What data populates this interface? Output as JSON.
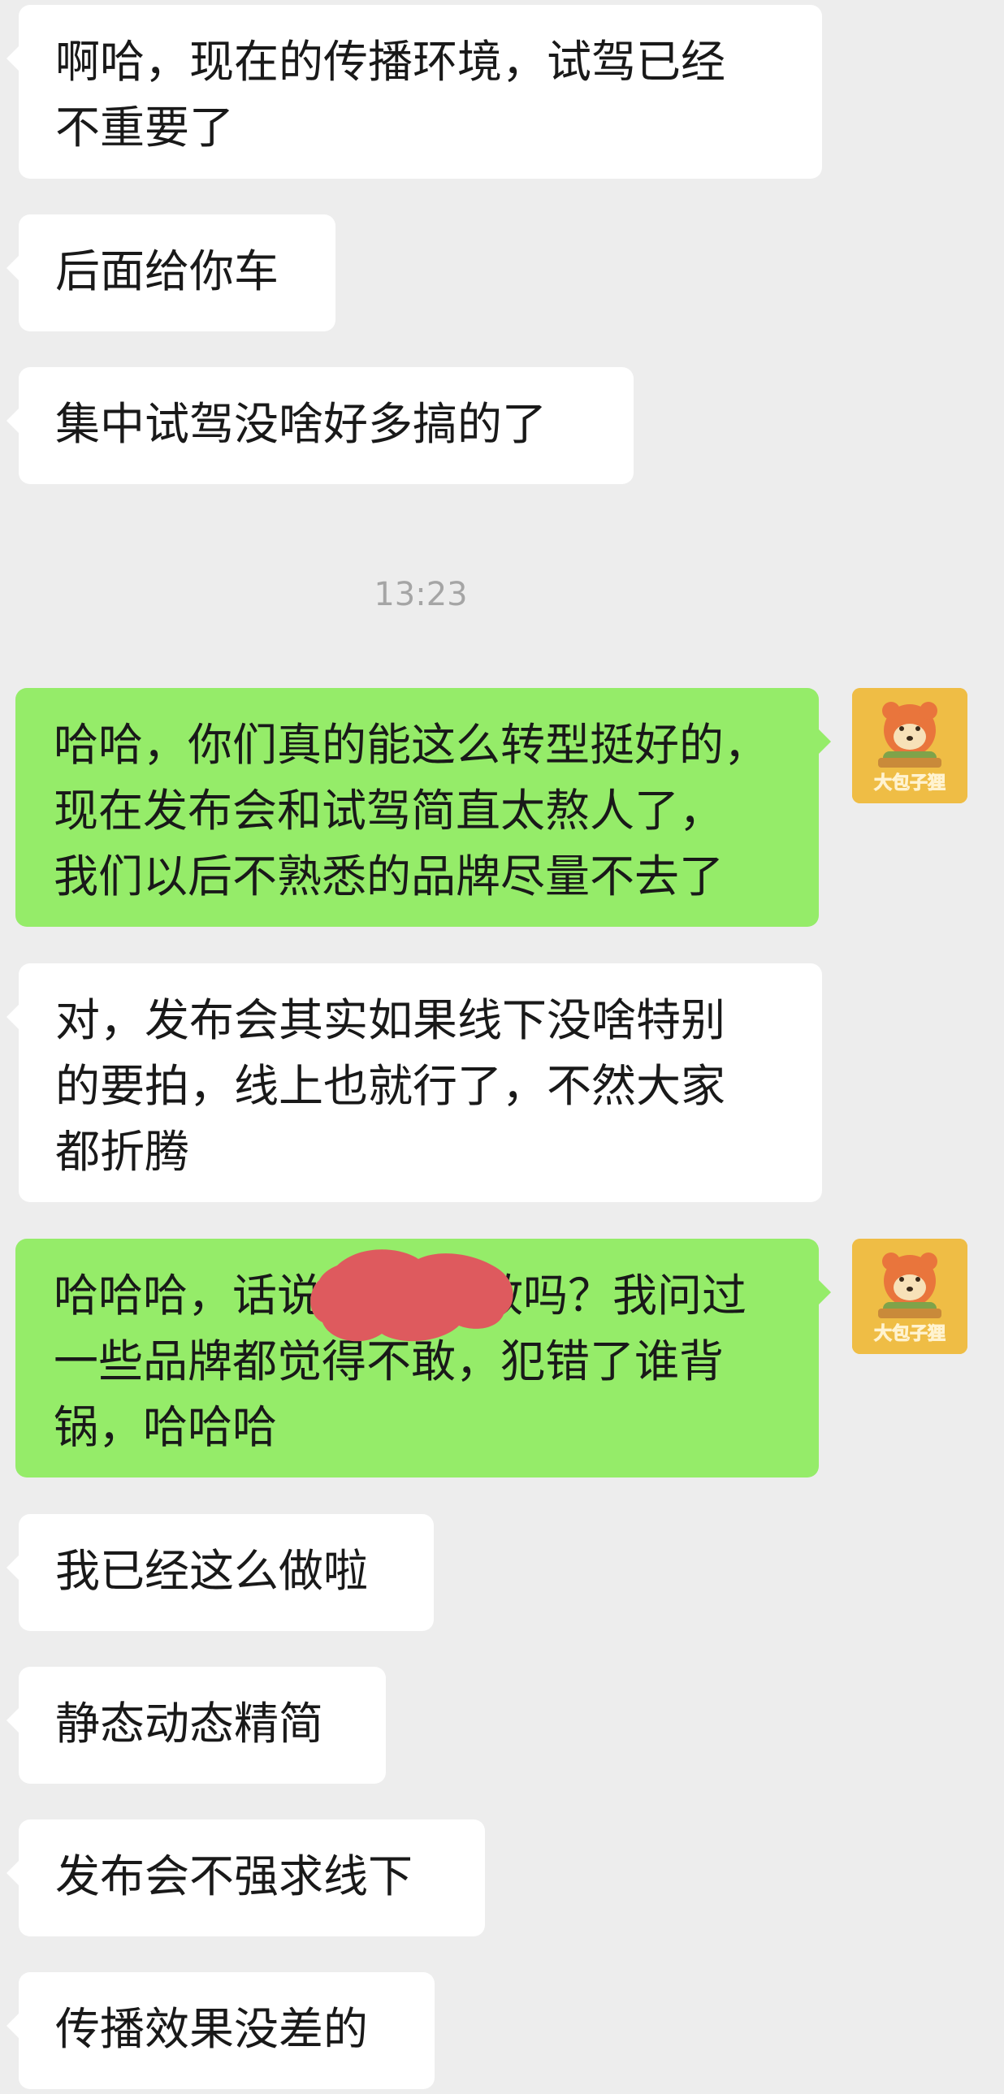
{
  "chat": {
    "messages": [
      {
        "direction": "incoming",
        "lines": [
          "啊哈，现在的传播环境，试驾已经",
          "不重要了"
        ]
      },
      {
        "direction": "incoming",
        "lines": [
          "后面给你车"
        ]
      },
      {
        "direction": "incoming",
        "lines": [
          "集中试驾没啥好多搞的了"
        ]
      },
      {
        "direction": "outgoing",
        "lines": [
          "哈哈，你们真的能这么转型挺好的，",
          "现在发布会和试驾简直太熬人了，",
          "我们以后不熟悉的品牌尽量不去了"
        ]
      },
      {
        "direction": "incoming",
        "lines": [
          "对，发布会其实如果线下没啥特别",
          "的要拍，线上也就行了，不然大家",
          "都折腾"
        ]
      },
      {
        "direction": "outgoing",
        "lines": [
          "哈哈哈，话说",
          "敢吗？我问过",
          "一些品牌都觉得不敢，犯错了谁背",
          "锅，哈哈哈"
        ]
      },
      {
        "direction": "incoming",
        "lines": [
          "我已经这么做啦"
        ]
      },
      {
        "direction": "incoming",
        "lines": [
          "静态动态精简"
        ]
      },
      {
        "direction": "incoming",
        "lines": [
          "发布会不强求线下"
        ]
      },
      {
        "direction": "incoming",
        "lines": [
          "传播效果没差的"
        ]
      }
    ],
    "timestamp": "13:23",
    "avatar_text": "大包子狸"
  },
  "colors": {
    "background": "#ededed",
    "incoming_bubble": "#ffffff",
    "outgoing_bubble": "#95ec69",
    "redaction": "#de5a5e"
  }
}
